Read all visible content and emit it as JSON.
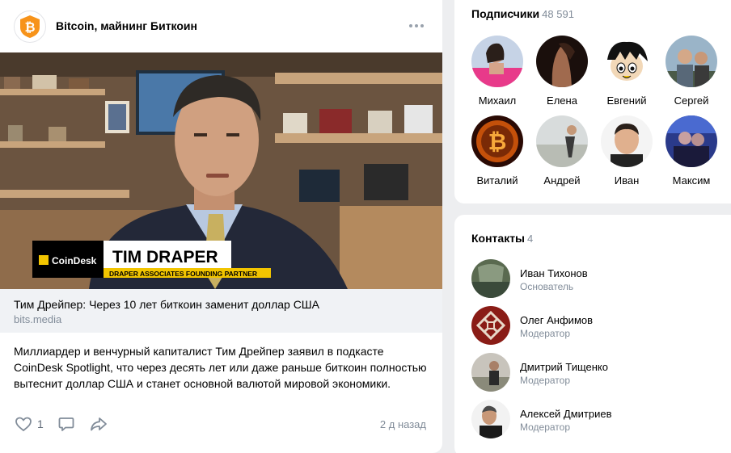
{
  "post": {
    "group_name": "Bitcoin, майнинг Биткоин",
    "group_avatar_icon": "bitcoin-logo-icon",
    "more_icon": "more-dots-icon",
    "video": {
      "logo_text": "CoinDesk",
      "name_text": "TIM DRAPER",
      "caption_text": "DRAPER ASSOCIATES FOUNDING PARTNER"
    },
    "link": {
      "title": "Тим Дрейпер: Через 10 лет биткоин заменит доллар США",
      "domain": "bits.media"
    },
    "text": "Миллиардер и венчурный капиталист Тим Дрейпер заявил в подкасте CoinDesk Spotlight, что через десять лет или даже раньше биткоин полностью вытеснит доллар США и станет основной валютой мировой экономики.",
    "likes": "1",
    "timestamp": "2 д назад",
    "icons": [
      "heart-icon",
      "comment-icon",
      "share-icon"
    ]
  },
  "subscribers": {
    "title": "Подписчики",
    "count": "48 591",
    "items": [
      {
        "name": "Михаил"
      },
      {
        "name": "Елена"
      },
      {
        "name": "Евгений"
      },
      {
        "name": "Сергей"
      },
      {
        "name": "Виталий"
      },
      {
        "name": "Андрей"
      },
      {
        "name": "Иван"
      },
      {
        "name": "Максим"
      }
    ]
  },
  "contacts": {
    "title": "Контакты",
    "count": "4",
    "items": [
      {
        "name": "Иван Тихонов",
        "role": "Основатель"
      },
      {
        "name": "Олег Анфимов",
        "role": "Модератор"
      },
      {
        "name": "Дмитрий Тищенко",
        "role": "Модератор"
      },
      {
        "name": "Алексей Дмитриев",
        "role": "Модератор"
      }
    ]
  },
  "colors": {
    "background": "#edeef0",
    "card": "#ffffff",
    "secondary_text": "#818c99",
    "icon": "#99a2ad",
    "bitcoin_orange": "#f7931a",
    "coindesk_yellow": "#f2c500"
  }
}
